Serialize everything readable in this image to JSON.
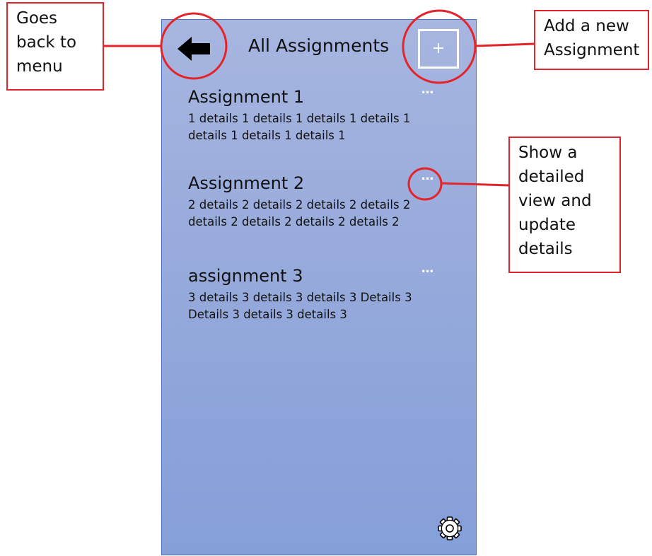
{
  "screen": {
    "title": "All Assignments",
    "add_button_label": "+",
    "assignments": [
      {
        "title": "Assignment 1",
        "details": "1 details 1 details 1 details 1 details 1 details 1 details 1 details 1",
        "more_label": "..."
      },
      {
        "title": "Assignment 2",
        "details": "2 details 2 details 2 details 2 details 2 details 2 details 2 details 2 details 2",
        "more_label": "..."
      },
      {
        "title": "assignment 3",
        "details": "3 details 3 details 3 details 3 Details  3 Details 3 details 3 details 3",
        "more_label": "..."
      }
    ]
  },
  "annotations": {
    "back": [
      "Goes",
      "back to",
      "menu"
    ],
    "add": [
      "Add a new",
      "Assignment"
    ],
    "details": [
      "Show a",
      "detailed",
      "view and",
      "update",
      "details"
    ]
  },
  "colors": {
    "annotation": "#e3242b",
    "phone_border": "#4a6fc4",
    "phone_top": "#a7b6e0",
    "phone_bottom": "#859fd9"
  },
  "icons": {
    "back": "arrow-left-icon",
    "add": "plus-icon",
    "more": "ellipsis-icon",
    "settings": "gear-icon"
  }
}
